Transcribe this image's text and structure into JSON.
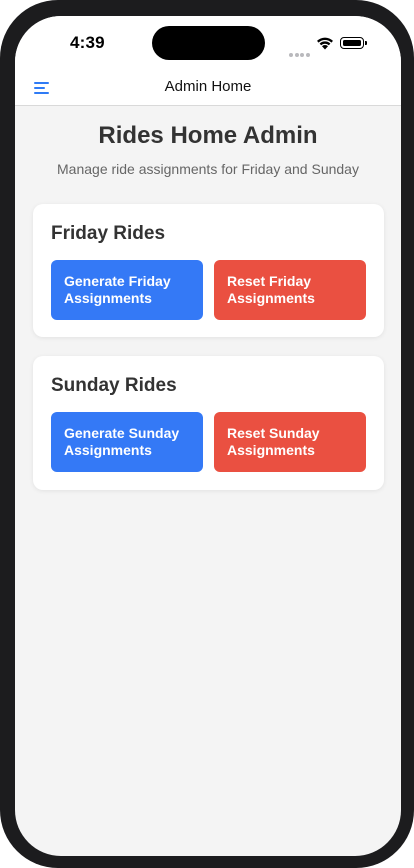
{
  "status_bar": {
    "time": "4:39"
  },
  "navbar": {
    "title": "Admin Home",
    "menu_icon": "hamburger-menu-icon"
  },
  "header": {
    "title": "Rides Home Admin",
    "subtitle": "Manage ride assignments for Friday and Sunday"
  },
  "sections": [
    {
      "title": "Friday Rides",
      "generate_label": "Generate Friday Assignments",
      "reset_label": "Reset Friday Assignments"
    },
    {
      "title": "Sunday Rides",
      "generate_label": "Generate Sunday Assignments",
      "reset_label": "Reset Sunday Assignments"
    }
  ],
  "colors": {
    "primary": "#3479f6",
    "danger": "#ea5041",
    "background": "#f4f4f4"
  }
}
